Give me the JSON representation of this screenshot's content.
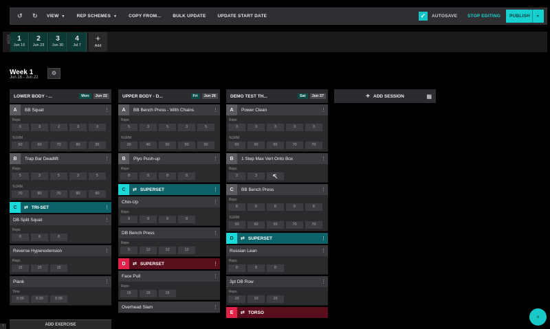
{
  "toolbar": {
    "undo_icon": "undo-icon",
    "redo_icon": "redo-icon",
    "view": "VIEW",
    "rep_schemes": "REP SCHEMES",
    "copy_from": "COPY FROM...",
    "bulk_update": "BULK UPDATE",
    "update_start_date": "UPDATE START DATE",
    "autosave": "AUTOSAVE",
    "stop_editing": "STOP EDITING",
    "publish": "PUBLISH",
    "accent": "#17cfcf"
  },
  "weeks": {
    "label": "WEEK",
    "items": [
      {
        "n": "1",
        "d": "Jun 16"
      },
      {
        "n": "2",
        "d": "Jun 23"
      },
      {
        "n": "3",
        "d": "Jun 30"
      },
      {
        "n": "4",
        "d": "Jul 7"
      }
    ],
    "add": "Add"
  },
  "header": {
    "title": "Week 1",
    "dates": "Jun 16 - Jun 22"
  },
  "col1": {
    "title": "LOWER BODY - ...",
    "day": "Mon",
    "date": "Jun 22",
    "ex_a": {
      "letter": "A",
      "name": "BB Squat",
      "l1": "Reps",
      "r1": [
        "5",
        "3",
        "2",
        "3",
        "3"
      ],
      "l2": "%1RM",
      "r2": [
        "50",
        "60",
        "70",
        "80",
        "85"
      ]
    },
    "ex_b": {
      "letter": "B",
      "name": "Trap Bar Deadlift",
      "l1": "Reps",
      "r1": [
        "5",
        "3",
        "5",
        "3",
        "5"
      ],
      "l2": "%1RM",
      "r2": [
        "70",
        "80",
        "70",
        "80",
        "80"
      ]
    },
    "grp_c": {
      "letter": "C",
      "name": "TRI-SET"
    },
    "ex_c1": {
      "name": "DB Split Squat",
      "l1": "Reps",
      "r1": [
        "8",
        "8",
        "8"
      ]
    },
    "ex_c2": {
      "name": "Reverse Hyperextension",
      "l1": "Reps",
      "r1": [
        "15",
        "15",
        "15"
      ]
    },
    "ex_c3": {
      "name": "Plank",
      "l1": "Time",
      "r1": [
        "0:30",
        "0:30",
        "0:30"
      ]
    },
    "add": "ADD EXERCISE"
  },
  "col2": {
    "title": "UPPER BODY - D...",
    "day": "Fri",
    "date": "Jun 26",
    "ex_a": {
      "letter": "A",
      "name": "BB Bench Press - With Chains",
      "l1": "Reps",
      "r1": [
        "5",
        "3",
        "5",
        "3",
        "5"
      ],
      "l2": "%1RM",
      "r2": [
        "20",
        "40",
        "50",
        "50",
        "50"
      ]
    },
    "ex_b": {
      "letter": "B",
      "name": "Plyo Push-up",
      "l1": "Reps",
      "r1": [
        "8",
        "8",
        "8",
        "8"
      ]
    },
    "grp_c": {
      "letter": "C",
      "name": "SUPERSET"
    },
    "ex_c1": {
      "name": "Chin-Up",
      "l1": "Reps",
      "r1": [
        "8",
        "8",
        "8",
        "8"
      ]
    },
    "ex_c2": {
      "name": "DB Bench Press",
      "l1": "Reps",
      "r1": [
        "5",
        "12",
        "12",
        "12"
      ]
    },
    "grp_d": {
      "letter": "D",
      "name": "SUPERSET"
    },
    "ex_d1": {
      "name": "Face Pull",
      "l1": "Reps",
      "r1": [
        "15",
        "15",
        "15"
      ]
    },
    "ex_d2": {
      "name": "Overhead Slam"
    }
  },
  "col3": {
    "title": "DEMO TEST TH...",
    "day": "Sat",
    "date": "Jun 27",
    "ex_a": {
      "letter": "A",
      "name": "Power Clean",
      "l1": "Reps",
      "r1": [
        "3",
        "3",
        "3",
        "3",
        "3"
      ],
      "l2": "%1RM",
      "r2": [
        "50",
        "60",
        "65",
        "70",
        "70"
      ]
    },
    "ex_b": {
      "letter": "B",
      "name": "1 Step Max Vert Onto Box",
      "l1": "Reps",
      "r1": [
        "2",
        "3",
        "3"
      ]
    },
    "ex_c": {
      "letter": "C",
      "name": "BB Bench Press",
      "l1": "Reps",
      "r1": [
        "6",
        "6",
        "6",
        "6",
        "6"
      ],
      "l2": "%1RM",
      "r2": [
        "50",
        "60",
        "55",
        "70",
        "70"
      ]
    },
    "grp_d": {
      "letter": "D",
      "name": "SUPERSET"
    },
    "ex_d1": {
      "name": "Russian Lean",
      "l1": "Reps",
      "r1": [
        "8",
        "8",
        "8"
      ]
    },
    "ex_d2": {
      "name": "3pt DB Row",
      "l1": "Reps",
      "r1": [
        "10",
        "10",
        "10"
      ]
    },
    "grp_e": {
      "letter": "E",
      "name": "TORSO"
    }
  },
  "add_session": "ADD SESSION"
}
